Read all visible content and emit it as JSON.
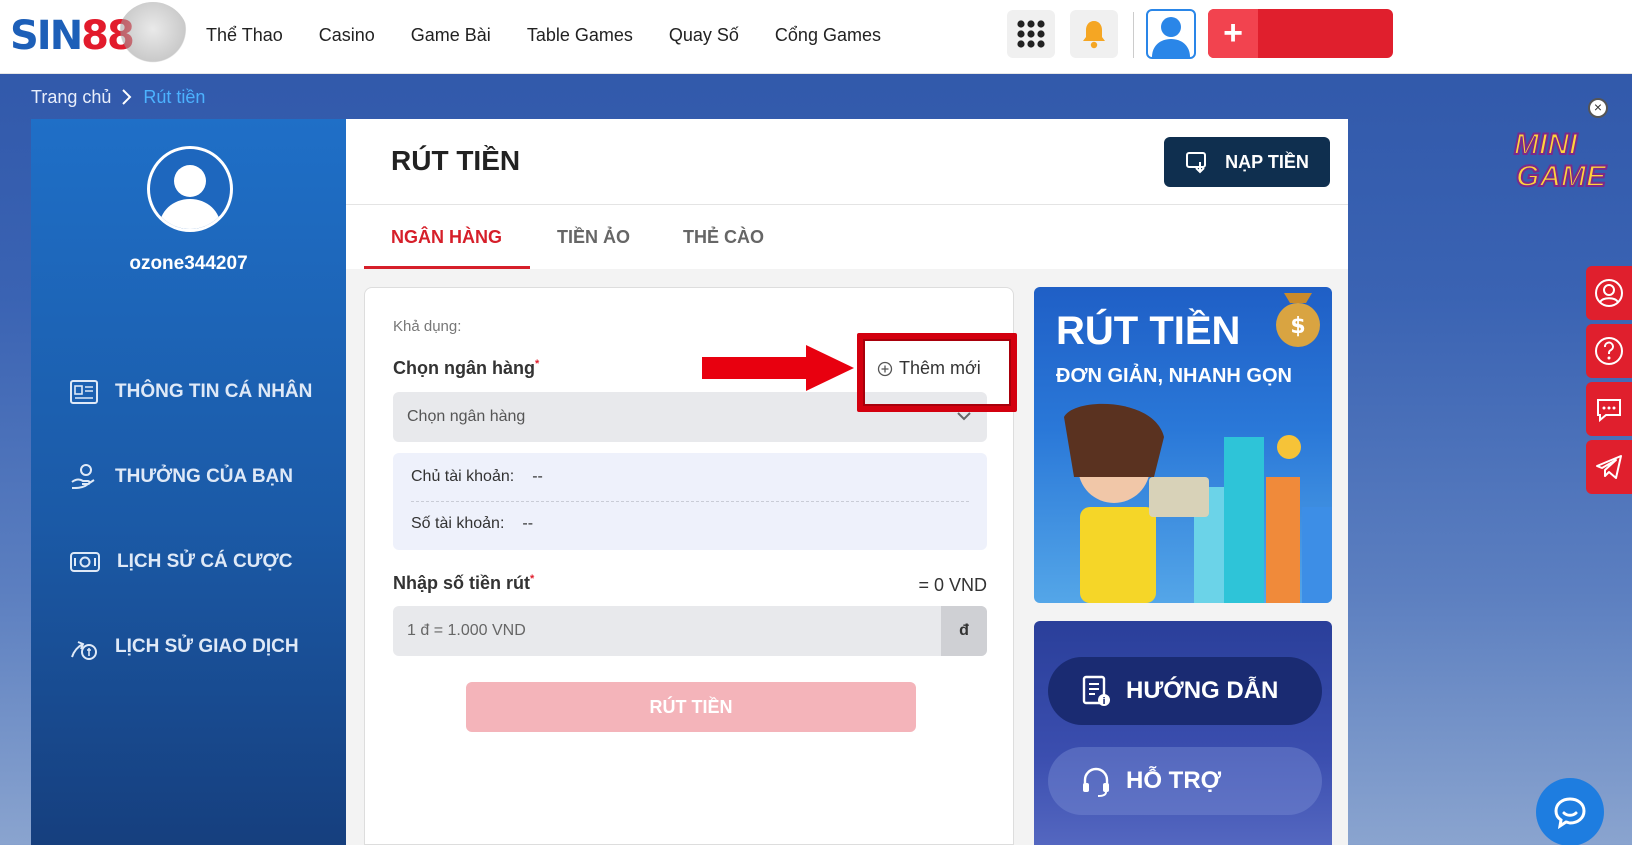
{
  "header": {
    "logo": {
      "blue": "SIN",
      "red": "88"
    },
    "nav": [
      "Thể Thao",
      "Casino",
      "Game Bài",
      "Table Games",
      "Quay Số",
      "Cổng Games"
    ],
    "deposit_symbol": "+"
  },
  "breadcrumb": {
    "home": "Trang chủ",
    "current": "Rút tiền"
  },
  "sidebar": {
    "username": "ozone344207",
    "menu": [
      {
        "label": "THÔNG TIN CÁ NHÂN",
        "icon": "profile-card-icon"
      },
      {
        "label": "THƯỞNG CỦA BẠN",
        "icon": "reward-hand-icon"
      },
      {
        "label": "LỊCH SỬ CÁ CƯỢC",
        "icon": "bet-history-icon"
      },
      {
        "label": "LỊCH SỬ GIAO DỊCH",
        "icon": "transaction-history-icon"
      }
    ]
  },
  "main": {
    "title": "RÚT TIỀN",
    "nap_button": "NẠP TIỀN",
    "tabs": [
      {
        "label": "NGÂN HÀNG",
        "active": true
      },
      {
        "label": "TIỀN ẢO",
        "active": false
      },
      {
        "label": "THẺ CÀO",
        "active": false
      }
    ],
    "form": {
      "available_label": "Khả dụng:",
      "bank_label": "Chọn ngân hàng",
      "add_new": "Thêm mới",
      "bank_placeholder": "Chọn ngân hàng",
      "account_holder_label": "Chủ tài khoản:",
      "account_holder_value": "--",
      "account_number_label": "Số tài khoản:",
      "account_number_value": "--",
      "amount_label": "Nhập số tiền rút",
      "amount_equals": "= 0 VND",
      "amount_placeholder": "1 đ = 1.000 VND",
      "amount_suffix": "đ",
      "submit": "RÚT TIỀN"
    },
    "promo": {
      "line1": "RÚT TIỀN",
      "line2": "ĐƠN GIẢN, NHANH GỌN",
      "guide": "HƯỚNG DẪN",
      "support": "HỖ TRỢ"
    }
  },
  "floating": {
    "minigame_word1": "MINI",
    "minigame_word2": "GAME",
    "close_symbol": "×",
    "rail_icons": [
      "user-icon",
      "help-icon",
      "chat-icon",
      "telegram-icon"
    ]
  },
  "colors": {
    "accent_red": "#e01f2d",
    "brand_blue": "#1d5fb8",
    "dark_navy": "#0f2f4f"
  }
}
